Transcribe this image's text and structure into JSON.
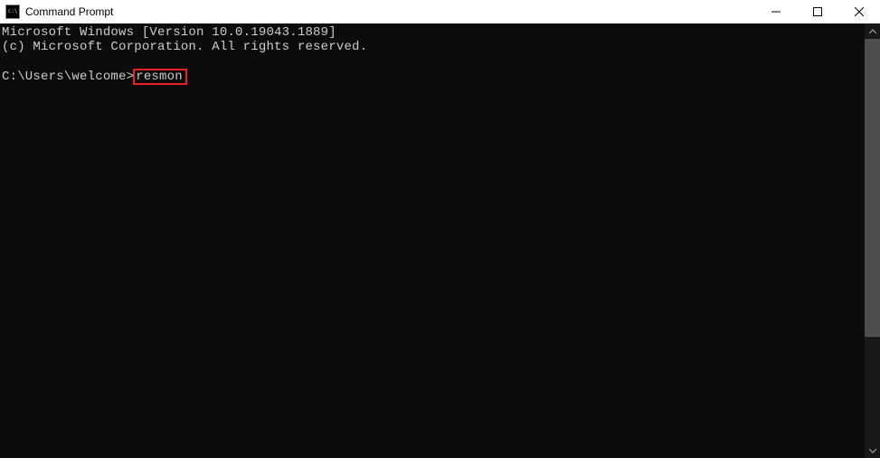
{
  "window": {
    "title": "Command Prompt"
  },
  "terminal": {
    "line1": "Microsoft Windows [Version 10.0.19043.1889]",
    "line2": "(c) Microsoft Corporation. All rights reserved.",
    "prompt": "C:\\Users\\welcome>",
    "command": "resmon"
  }
}
